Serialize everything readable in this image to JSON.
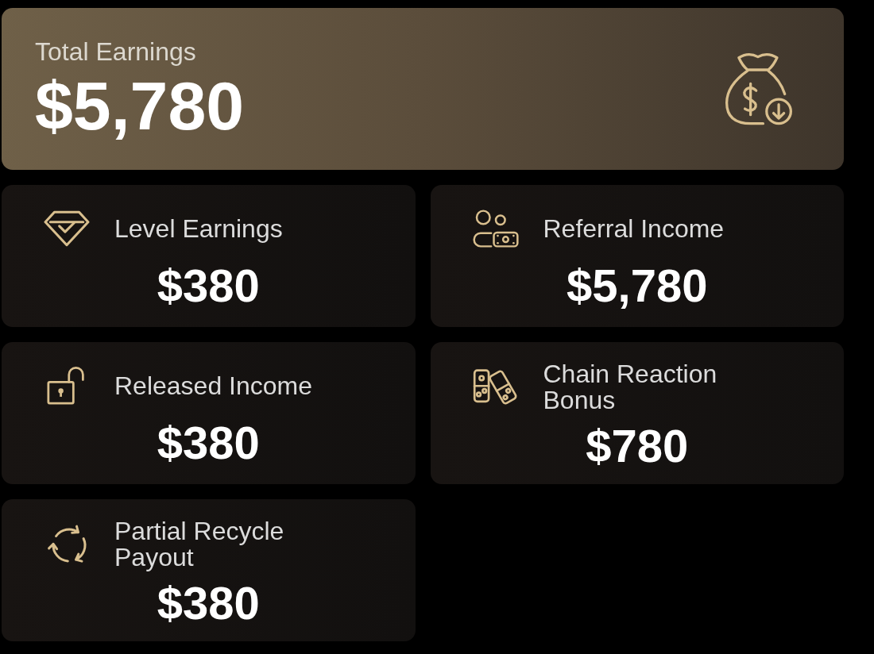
{
  "total": {
    "label": "Total Earnings",
    "amount": "$5,780"
  },
  "cards": [
    {
      "label": "Level Earnings",
      "amount": "$380"
    },
    {
      "label": "Referral Income",
      "amount": "$5,780"
    },
    {
      "label": "Released Income",
      "amount": "$380"
    },
    {
      "label": "Chain Reaction Bonus",
      "amount": "$780"
    },
    {
      "label": "Partial Recycle Payout",
      "amount": "$380"
    }
  ]
}
